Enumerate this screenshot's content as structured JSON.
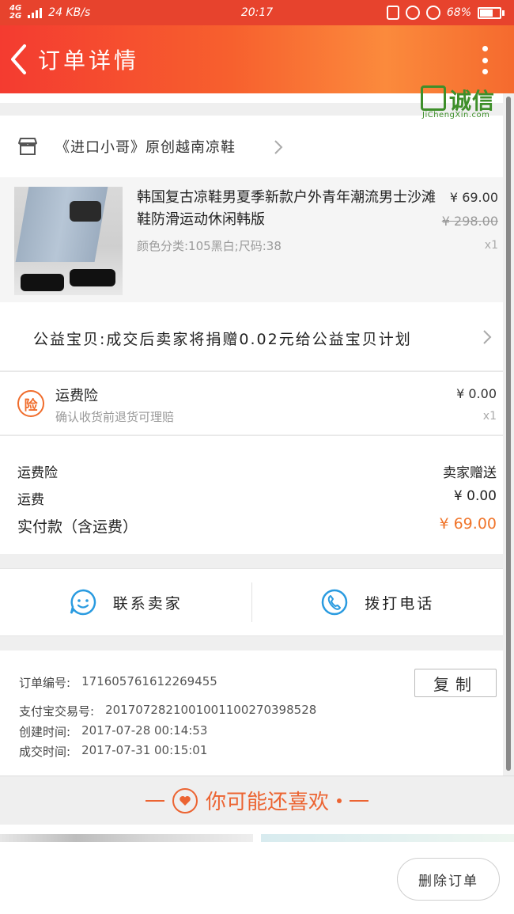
{
  "status_bar": {
    "network": "4G",
    "network2": "2G",
    "speed": "24 KB/s",
    "time": "20:17",
    "battery": "68%",
    "battery_level": 0.68
  },
  "header": {
    "title": "订单详情"
  },
  "shop": {
    "name": "《进口小哥》原创越南凉鞋"
  },
  "product": {
    "name": "韩国复古凉鞋男夏季新款户外青年潮流男士沙滩鞋防滑运动休闲韩版",
    "spec": "颜色分类:105黑白;尺码:38",
    "price": "¥ 69.00",
    "original_price": "¥ 298.00",
    "quantity": "x1"
  },
  "charity": {
    "text": "公益宝贝:成交后卖家将捐赠0.02元给公益宝贝计划"
  },
  "insurance": {
    "badge": "险",
    "title": "运费险",
    "desc": "确认收货前退货可理赔",
    "price": "¥ 0.00",
    "quantity": "x1"
  },
  "costs": {
    "rows": [
      {
        "label": "运费险",
        "value": "卖家赠送"
      },
      {
        "label": "运费",
        "value": "¥ 0.00"
      },
      {
        "label": "实付款（含运费）",
        "value": "¥ 69.00"
      }
    ],
    "accent_color": "#f0752b"
  },
  "contact": {
    "seller_label": "联系卖家",
    "phone_label": "拨打电话"
  },
  "order_info": {
    "order_no_label": "订单编号:",
    "order_no": "171605761612269455",
    "alipay_label": "支付宝交易号:",
    "alipay_no": "2017072821001001100270398528",
    "created_label": "创建时间:",
    "created": "2017-07-28 00:14:53",
    "completed_label": "成交时间:",
    "completed": "2017-07-31 00:15:01",
    "copy_label": "复制"
  },
  "recommend": {
    "title": "你可能还喜欢"
  },
  "bottom": {
    "delete_label": "删除订单",
    "watermark_text": "诚信",
    "watermark_sub": "JiChengXin.com"
  },
  "colors": {
    "header_start": "#f43b30",
    "header_end": "#fb8a3c",
    "accent": "#ec6432",
    "icon_blue": "#2a9be0"
  }
}
